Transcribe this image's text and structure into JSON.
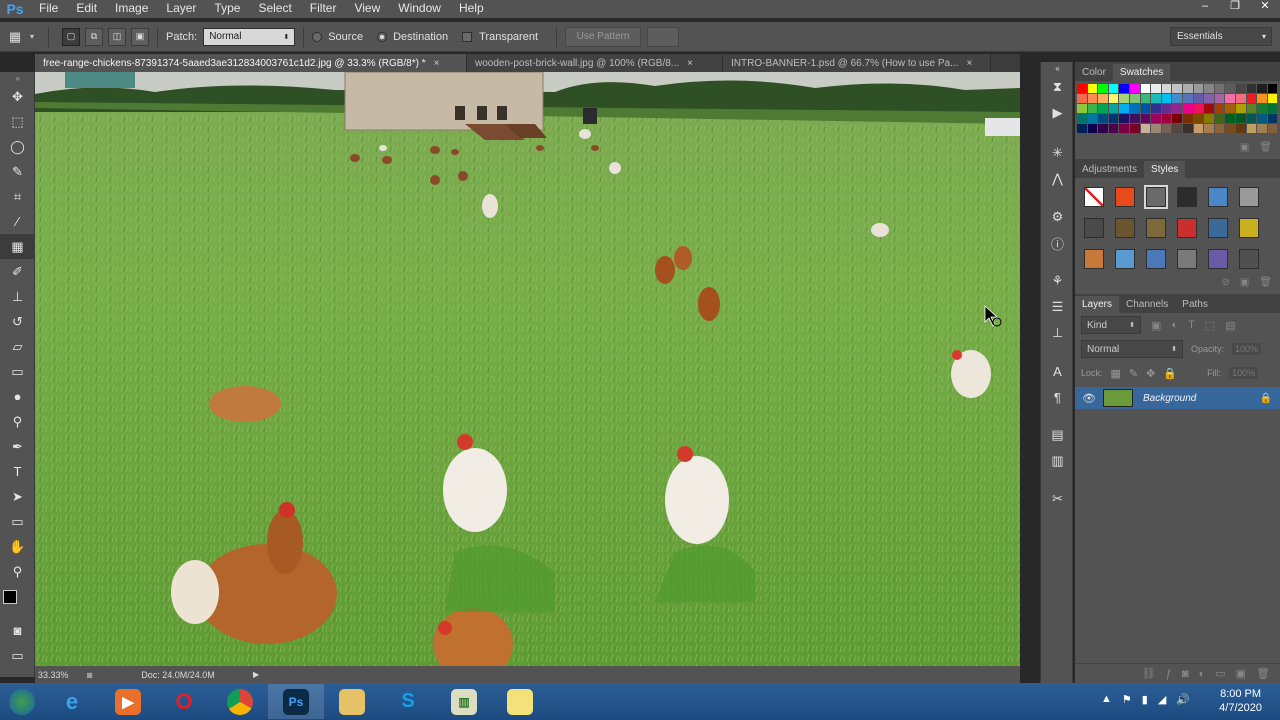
{
  "app": {
    "logo": "Ps",
    "menu": [
      "File",
      "Edit",
      "Image",
      "Layer",
      "Type",
      "Select",
      "Filter",
      "View",
      "Window",
      "Help"
    ],
    "window_controls": [
      "–",
      "❐",
      "✕"
    ]
  },
  "options": {
    "patch_label": "Patch:",
    "patch_mode": "Normal",
    "source_label": "Source",
    "destination_label": "Destination",
    "transparent_label": "Transparent",
    "use_pattern_label": "Use Pattern",
    "workspace": "Essentials"
  },
  "tabs": [
    {
      "label": "free-range-chickens-87391374-5aaed3ae312834003761c1d2.jpg @ 33.3% (RGB/8*) *",
      "close": "×",
      "active": true
    },
    {
      "label": "wooden-post-brick-wall.jpg @ 100% (RGB/8...",
      "close": "×",
      "active": false
    },
    {
      "label": "INTRO-BANNER-1.psd @ 66.7% (How to use Pa...",
      "close": "×",
      "active": false
    }
  ],
  "status": {
    "zoom": "33.33%",
    "doc": "Doc: 24.0M/24.0M"
  },
  "panels": {
    "color_tabs": [
      "Color",
      "Swatches"
    ],
    "styles_tabs": [
      "Adjustments",
      "Styles"
    ],
    "layers_tabs": [
      "Layers",
      "Channels",
      "Paths"
    ],
    "kind_label": "Kind",
    "blend_mode": "Normal",
    "opacity_label": "Opacity:",
    "opacity_value": "100%",
    "lock_label": "Lock:",
    "fill_label": "Fill:",
    "fill_value": "100%",
    "layer_name": "Background"
  },
  "swatch_colors": [
    "#ff0000",
    "#ffff00",
    "#00ff00",
    "#00ffff",
    "#0000ff",
    "#ff00ff",
    "#ffffff",
    "#ebebeb",
    "#d6d6d6",
    "#c2c2c2",
    "#adadad",
    "#999999",
    "#858585",
    "#707070",
    "#5c5c5c",
    "#474747",
    "#333333",
    "#1f1f1f",
    "#000000",
    "#f26c4f",
    "#f68e56",
    "#fbaf5d",
    "#fff568",
    "#acd372",
    "#7cc576",
    "#3bb878",
    "#1abbb4",
    "#00bff3",
    "#438ccb",
    "#5574b9",
    "#605ca8",
    "#855fa8",
    "#a763a8",
    "#f06ea9",
    "#f26d7d",
    "#ed1c24",
    "#f7941d",
    "#fff200",
    "#8dc63f",
    "#39b54a",
    "#00a651",
    "#00a99d",
    "#00aeef",
    "#0072bc",
    "#0054a6",
    "#2e3192",
    "#662d91",
    "#92278f",
    "#ec008c",
    "#ed145b",
    "#9e0b0f",
    "#a0410d",
    "#a36209",
    "#aba000",
    "#598527",
    "#197b30",
    "#007236",
    "#00746b",
    "#0076a3",
    "#004b80",
    "#003471",
    "#1b1464",
    "#440e62",
    "#630460",
    "#9e005d",
    "#9e0039",
    "#790000",
    "#7b2e00",
    "#7d4900",
    "#827b00",
    "#406618",
    "#005e20",
    "#005826",
    "#005952",
    "#005b7f",
    "#003663",
    "#002157",
    "#0d004c",
    "#32004b",
    "#4b0049",
    "#7b0046",
    "#7a0026",
    "#c7b299",
    "#998675",
    "#736357",
    "#534741",
    "#37302a",
    "#c69c6d",
    "#a67c52",
    "#8c6239",
    "#754c24",
    "#603913",
    "#c0a060",
    "#a08050",
    "#806040"
  ],
  "styles": [
    "#ffffff",
    "#e84a1b",
    "#6a6a6a",
    "#2c2c2c",
    "#4b86c6",
    "#9a9a9a",
    "#4a4a4a",
    "#6b5530",
    "#7d6a3a",
    "#c83030",
    "#3a6a9a",
    "#c8b020",
    "#c87838",
    "#5a9ad0",
    "#4a78b8",
    "#7a7a7a",
    "#6a5aa8",
    "#505050"
  ],
  "taskbar": [
    "e",
    "O",
    "G",
    "Ps",
    "F",
    "S",
    "X",
    "D"
  ],
  "clock": {
    "time": "8:00 PM",
    "date": "4/7/2020"
  }
}
